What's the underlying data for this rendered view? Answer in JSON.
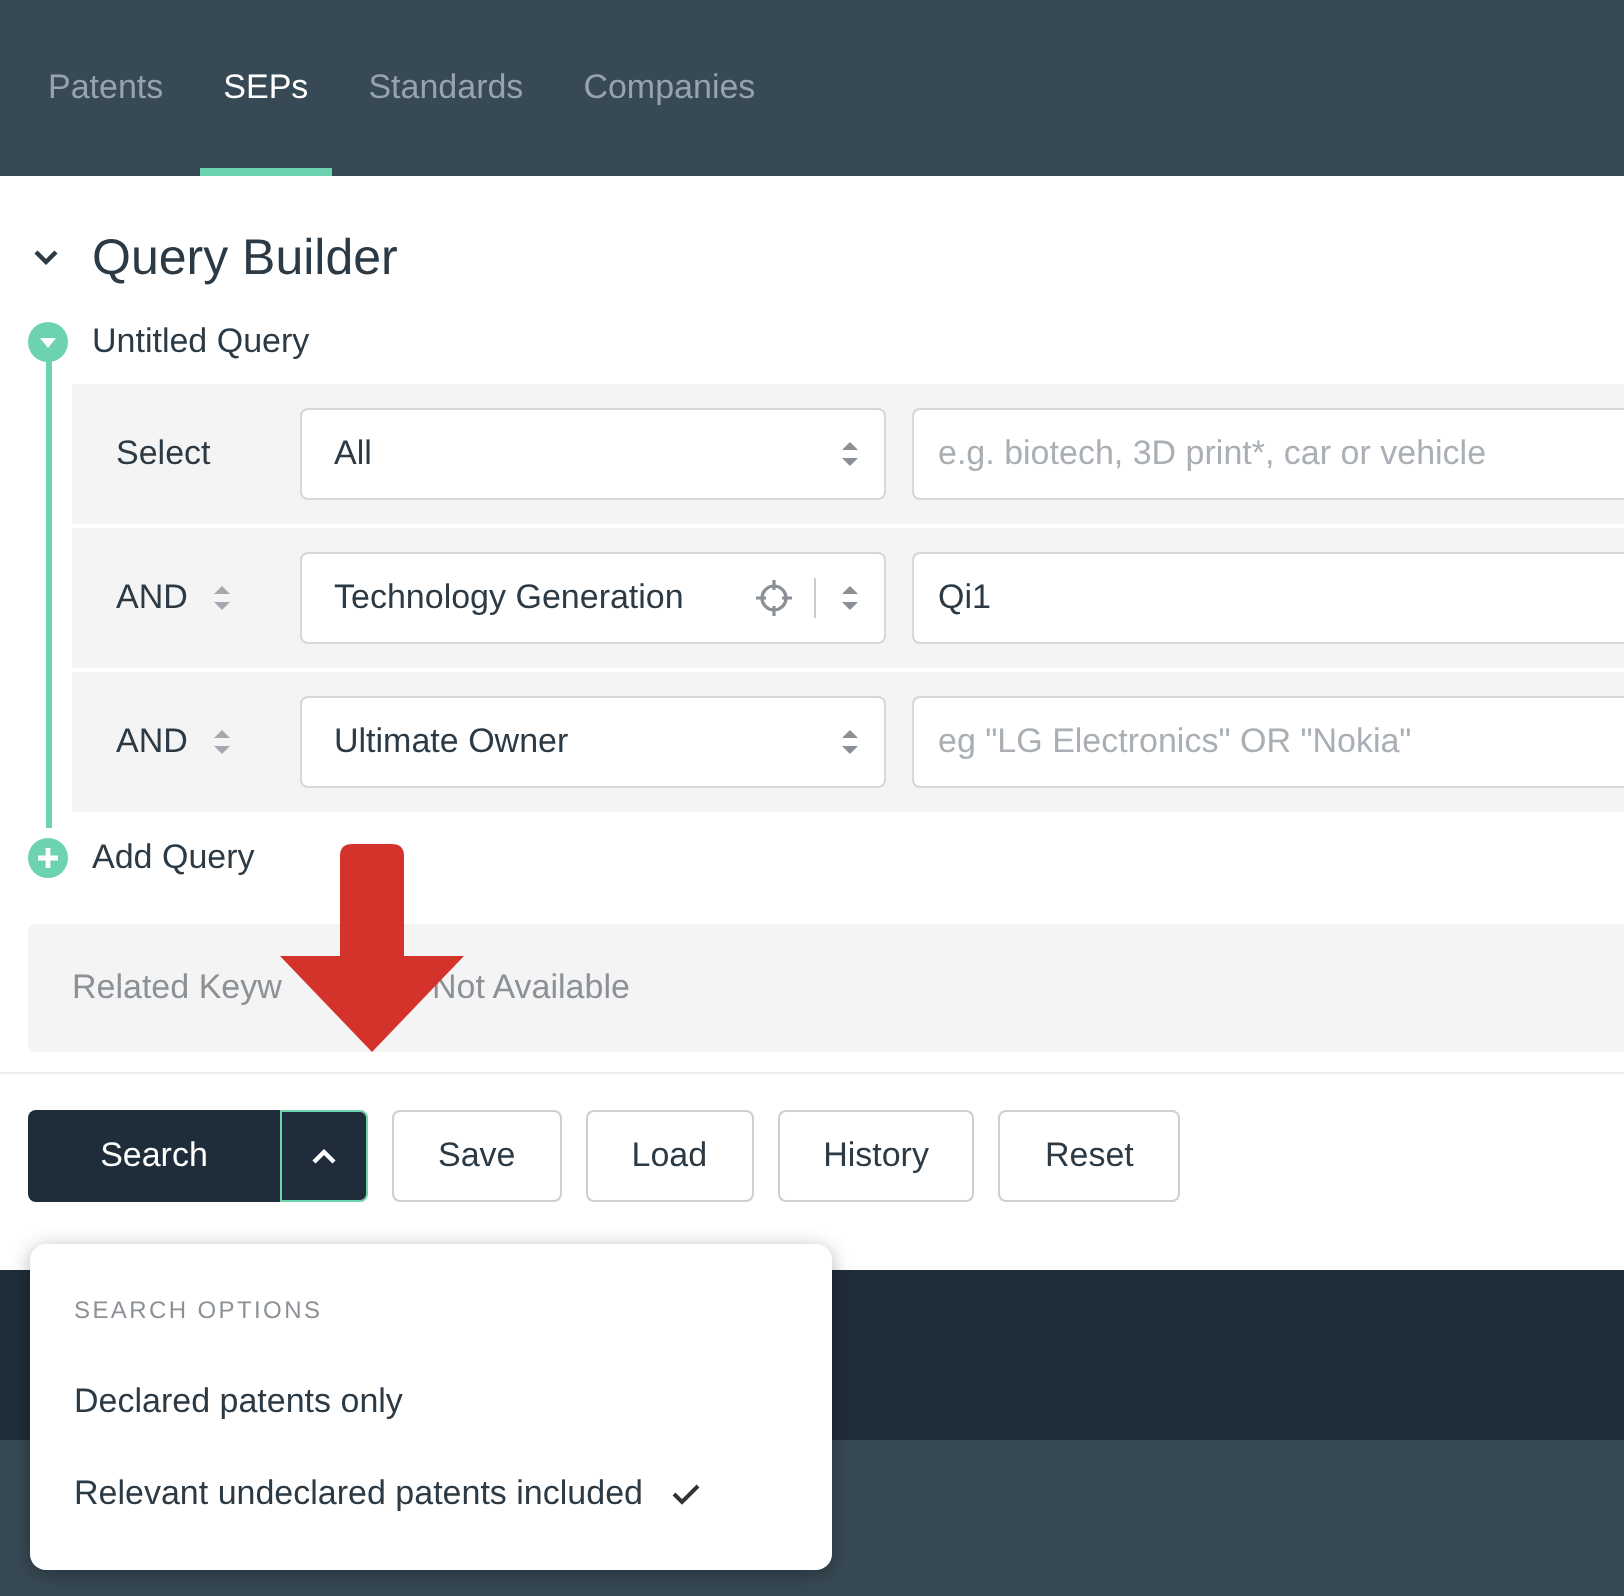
{
  "tabs": [
    {
      "label": "Patents",
      "selected": false
    },
    {
      "label": "SEPs",
      "selected": true
    },
    {
      "label": "Standards",
      "selected": false
    },
    {
      "label": "Companies",
      "selected": false
    }
  ],
  "query_builder": {
    "title": "Query Builder",
    "expanded": true,
    "query": {
      "name": "Untitled Query",
      "expanded": true,
      "rows": [
        {
          "kind": "first",
          "operator": "Select",
          "field": "All",
          "target_icon": false,
          "placeholder": "e.g. biotech, 3D print*, car or vehicle"
        },
        {
          "kind": "condition",
          "operator": "AND",
          "field": "Technology Generation",
          "target_icon": true,
          "value": "Qi1"
        },
        {
          "kind": "condition",
          "operator": "AND",
          "field": "Ultimate Owner",
          "target_icon": false,
          "placeholder": "eg \"LG Electronics\" OR \"Nokia\""
        }
      ]
    },
    "add_query": "Add Query",
    "related": {
      "label": "Related Keyw",
      "value": "Not Available"
    }
  },
  "actions": {
    "search": "Search",
    "menu_open": true,
    "buttons": [
      "Save",
      "Load",
      "History",
      "Reset"
    ]
  },
  "search_options": {
    "heading": "SEARCH OPTIONS",
    "options": [
      {
        "label": "Declared patents only",
        "selected": false
      },
      {
        "label": "Relevant undeclared patents included",
        "selected": true
      }
    ]
  }
}
